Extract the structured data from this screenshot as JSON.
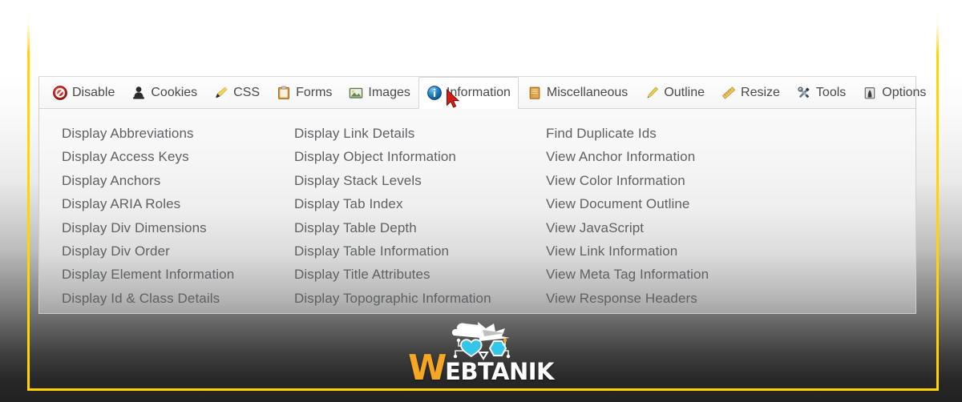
{
  "frame": {
    "accent_color": "#ffd400"
  },
  "toolbar": {
    "name": "web-developer-toolbar",
    "active_tab": "Information",
    "tabs": [
      {
        "label": "Disable",
        "icon": "prohibition-icon",
        "active": false
      },
      {
        "label": "Cookies",
        "icon": "stamp-icon",
        "active": false
      },
      {
        "label": "CSS",
        "icon": "paintbrush-icon",
        "active": false
      },
      {
        "label": "Forms",
        "icon": "clipboard-icon",
        "active": false
      },
      {
        "label": "Images",
        "icon": "picture-icon",
        "active": false
      },
      {
        "label": "Information",
        "icon": "info-circle-icon",
        "active": true
      },
      {
        "label": "Miscellaneous",
        "icon": "book-icon",
        "active": false
      },
      {
        "label": "Outline",
        "icon": "pencil-icon",
        "active": false
      },
      {
        "label": "Resize",
        "icon": "ruler-icon",
        "active": false
      },
      {
        "label": "Tools",
        "icon": "wrench-screwdriver-icon",
        "active": false
      },
      {
        "label": "Options",
        "icon": "options-icon",
        "active": false
      }
    ]
  },
  "information_menu": {
    "columns": [
      {
        "name": "column-display-a",
        "items": [
          "Display Abbreviations",
          "Display Access Keys",
          "Display Anchors",
          "Display ARIA Roles",
          "Display Div Dimensions",
          "Display Div Order",
          "Display Element Information",
          "Display Id & Class Details"
        ]
      },
      {
        "name": "column-display-b",
        "items": [
          "Display Link Details",
          "Display Object Information",
          "Display Stack Levels",
          "Display Tab Index",
          "Display Table Depth",
          "Display Table Information",
          "Display Title Attributes",
          "Display Topographic Information"
        ]
      },
      {
        "name": "column-view",
        "items": [
          "Find Duplicate Ids",
          "View Anchor Information",
          "View Color Information",
          "View Document Outline",
          "View JavaScript",
          "View Link Information",
          "View Meta Tag Information",
          "View Response Headers"
        ]
      }
    ]
  },
  "watermark": {
    "name": "webtanik-watermark",
    "text_first": "W",
    "text_rest": "EBTANIK",
    "brand_color": "#f5a623"
  },
  "cursor": {
    "name": "mouse-pointer",
    "color": "#d0211c"
  }
}
